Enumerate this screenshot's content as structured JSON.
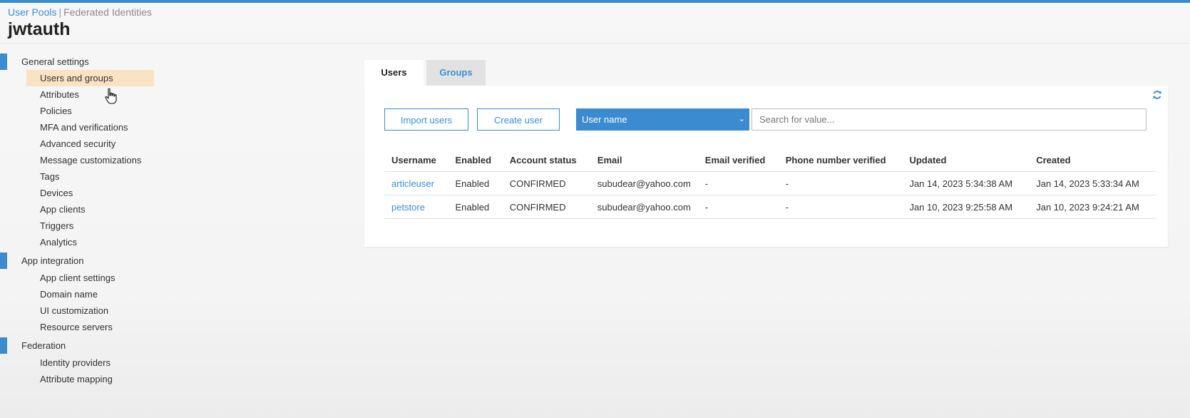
{
  "breadcrumb": {
    "user_pools": "User Pools",
    "separator": "|",
    "federated": "Federated Identities"
  },
  "pool_name": "jwtauth",
  "sidebar": {
    "general": {
      "title": "General settings",
      "items": [
        "Users and groups",
        "Attributes",
        "Policies",
        "MFA and verifications",
        "Advanced security",
        "Message customizations",
        "Tags",
        "Devices",
        "App clients",
        "Triggers",
        "Analytics"
      ]
    },
    "app_integration": {
      "title": "App integration",
      "items": [
        "App client settings",
        "Domain name",
        "UI customization",
        "Resource servers"
      ]
    },
    "federation": {
      "title": "Federation",
      "items": [
        "Identity providers",
        "Attribute mapping"
      ]
    },
    "active_item": "Users and groups"
  },
  "tabs": [
    "Users",
    "Groups"
  ],
  "toolbar": {
    "import_label": "Import users",
    "create_label": "Create user",
    "select_value": "User name",
    "search_placeholder": "Search for value..."
  },
  "table": {
    "headers": [
      "Username",
      "Enabled",
      "Account status",
      "Email",
      "Email verified",
      "Phone number verified",
      "Updated",
      "Created"
    ],
    "rows": [
      [
        "articleuser",
        "Enabled",
        "CONFIRMED",
        "subudear@yahoo.com",
        "-",
        "-",
        "Jan 14, 2023 5:34:38 AM",
        "Jan 14, 2023 5:33:34 AM"
      ],
      [
        "petstore",
        "Enabled",
        "CONFIRMED",
        "subudear@yahoo.com",
        "-",
        "-",
        "Jan 10, 2023 9:25:58 AM",
        "Jan 10, 2023 9:24:21 AM"
      ]
    ]
  },
  "icons": {
    "refresh": "refresh-icon",
    "caret": "chevron-down-icon",
    "cursor": "hand-pointer-icon"
  },
  "colors": {
    "accent": "#3a8bd0",
    "link": "#3b8fd6",
    "active_bg": "#fae3c3"
  }
}
